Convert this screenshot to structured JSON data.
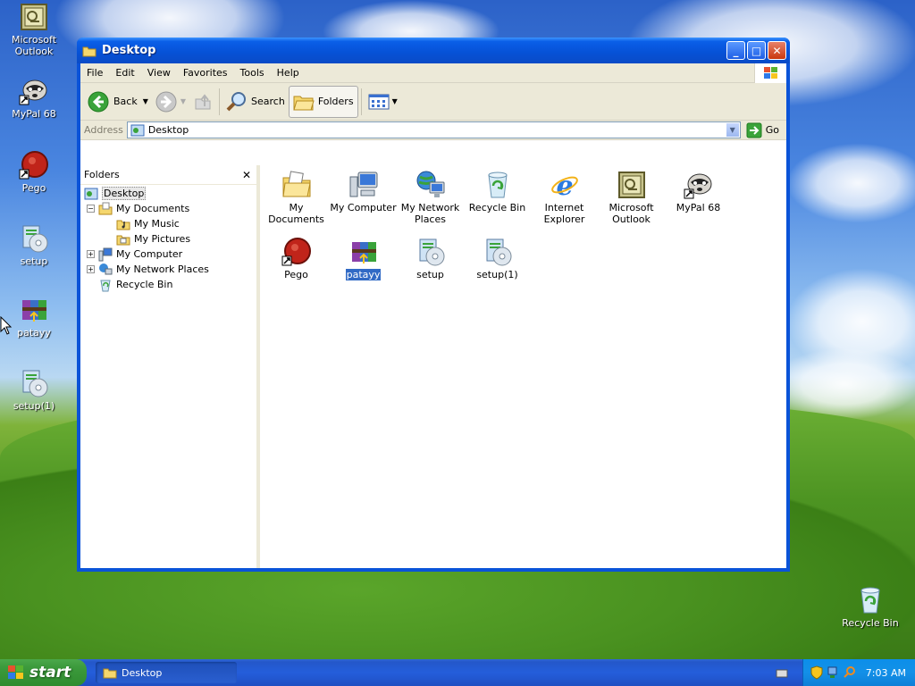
{
  "desktop": {
    "icons": [
      {
        "label": "Microsoft Outlook",
        "icon": "outlook-icon"
      },
      {
        "label": "MyPal 68",
        "icon": "mypal-icon"
      },
      {
        "label": "Pego",
        "icon": "pego-icon"
      },
      {
        "label": "setup",
        "icon": "setup-icon"
      },
      {
        "label": "patayy",
        "icon": "archive-icon"
      },
      {
        "label": "setup(1)",
        "icon": "setup-icon"
      },
      {
        "label": "Recycle Bin",
        "icon": "recycle-bin-icon"
      }
    ]
  },
  "window": {
    "title": "Desktop",
    "menu": [
      "File",
      "Edit",
      "View",
      "Favorites",
      "Tools",
      "Help"
    ],
    "toolbar": {
      "back": "Back",
      "search": "Search",
      "folders": "Folders"
    },
    "address": {
      "label": "Address",
      "value": "Desktop",
      "go": "Go"
    },
    "folders_pane": {
      "title": "Folders",
      "tree": [
        {
          "label": "Desktop",
          "level": 0,
          "expander": "",
          "selected": true
        },
        {
          "label": "My Documents",
          "level": 1,
          "expander": "−"
        },
        {
          "label": "My Music",
          "level": 2,
          "expander": ""
        },
        {
          "label": "My Pictures",
          "level": 2,
          "expander": ""
        },
        {
          "label": "My Computer",
          "level": 1,
          "expander": "+"
        },
        {
          "label": "My Network Places",
          "level": 1,
          "expander": "+"
        },
        {
          "label": "Recycle Bin",
          "level": 1,
          "expander": ""
        }
      ]
    },
    "files": [
      {
        "label": "My Documents",
        "icon": "my-documents-icon"
      },
      {
        "label": "My Computer",
        "icon": "my-computer-icon"
      },
      {
        "label": "My Network Places",
        "icon": "network-places-icon"
      },
      {
        "label": "Recycle Bin",
        "icon": "recycle-bin-icon"
      },
      {
        "label": "Internet Explorer",
        "icon": "internet-explorer-icon"
      },
      {
        "label": "Microsoft Outlook",
        "icon": "outlook-icon"
      },
      {
        "label": "MyPal 68",
        "icon": "mypal-icon"
      },
      {
        "label": "Pego",
        "icon": "pego-icon"
      },
      {
        "label": "patayy",
        "icon": "archive-icon",
        "selected": true
      },
      {
        "label": "setup",
        "icon": "setup-icon"
      },
      {
        "label": "setup(1)",
        "icon": "setup-icon"
      }
    ]
  },
  "taskbar": {
    "start_label": "start",
    "task_label": "Desktop",
    "clock": "7:03 AM"
  }
}
